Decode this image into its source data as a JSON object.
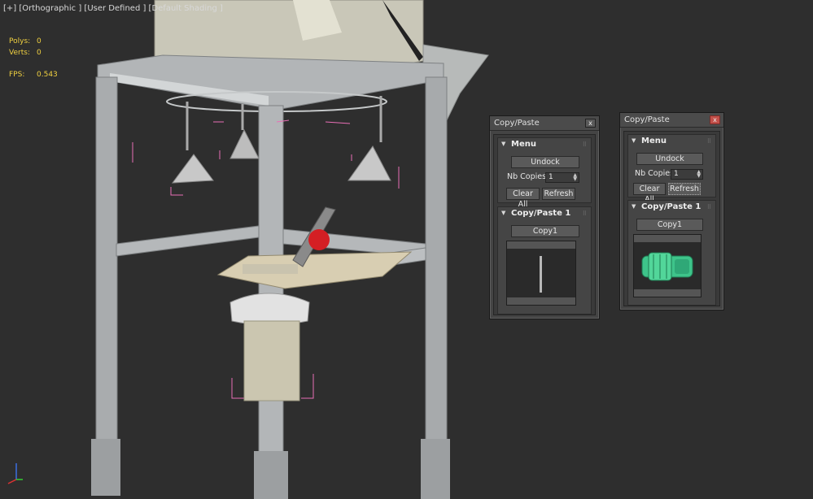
{
  "viewport": {
    "label": "[+] [Orthographic ] [User Defined ] [Default Shading ]",
    "stats": [
      {
        "name": "Polys:",
        "value": "0"
      },
      {
        "name": "Verts:",
        "value": "0"
      },
      {
        "name": "FPS:",
        "value": "0.543"
      }
    ]
  },
  "panels": [
    {
      "title": "Copy/Paste",
      "close": "x",
      "menu_title": "Menu",
      "undock": "Undock",
      "nb_copies_label": "Nb Copies",
      "nb_copies_value": "1",
      "clear_all": "Clear All",
      "refresh": "Refresh",
      "copy_title": "Copy/Paste 1",
      "copy_button": "Copy1"
    },
    {
      "title": "Copy/Paste",
      "close": "x",
      "menu_title": "Menu",
      "undock": "Undock",
      "nb_copies_label": "Nb Copies",
      "nb_copies_value": "1",
      "clear_all": "Clear All",
      "refresh": "Refresh",
      "copy_title": "Copy/Paste 1",
      "copy_button": "Copy1"
    }
  ],
  "colors": {
    "viewport_bg": "#2e2e2e",
    "stat_text": "#f0d040",
    "frame_metal": "#a9acae",
    "selection_brackets": "#e86fb6",
    "thumbnail_mesh": "#3ec48a",
    "close_red": "#c2504a"
  }
}
